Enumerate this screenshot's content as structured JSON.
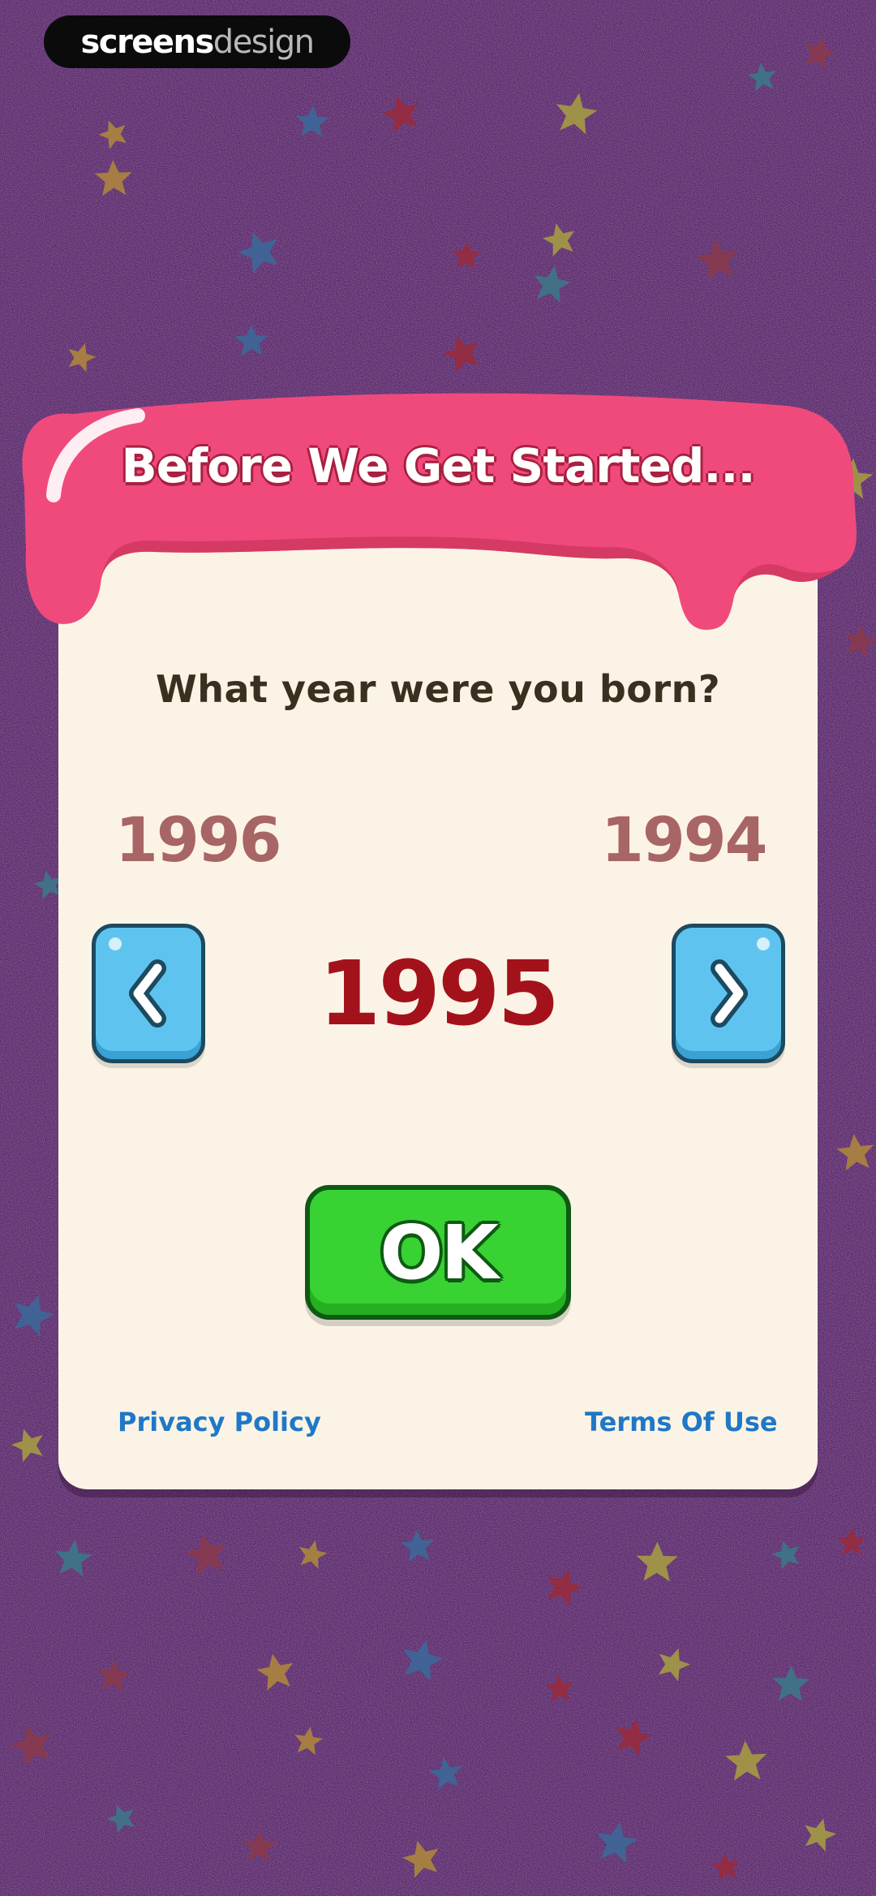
{
  "watermark": {
    "part1": "screens",
    "part2": "design"
  },
  "dialog": {
    "title": "Before We Get Started...",
    "question": "What year were you born?"
  },
  "year_picker": {
    "previous": "1996",
    "current": "1995",
    "next": "1994"
  },
  "buttons": {
    "ok_label": "OK",
    "back_icon": "chevron-left-icon",
    "forward_icon": "chevron-right-icon"
  },
  "links": {
    "privacy": "Privacy Policy",
    "terms": "Terms Of Use"
  },
  "colors": {
    "background": "#5c2a6e",
    "frosting": "#f04a7c",
    "card": "#fbf4e6",
    "current_year": "#a3121b",
    "side_year": "#a86565",
    "arrow_button": "#5ec4ef",
    "ok_button": "#38d233",
    "link": "#1f78c7"
  }
}
